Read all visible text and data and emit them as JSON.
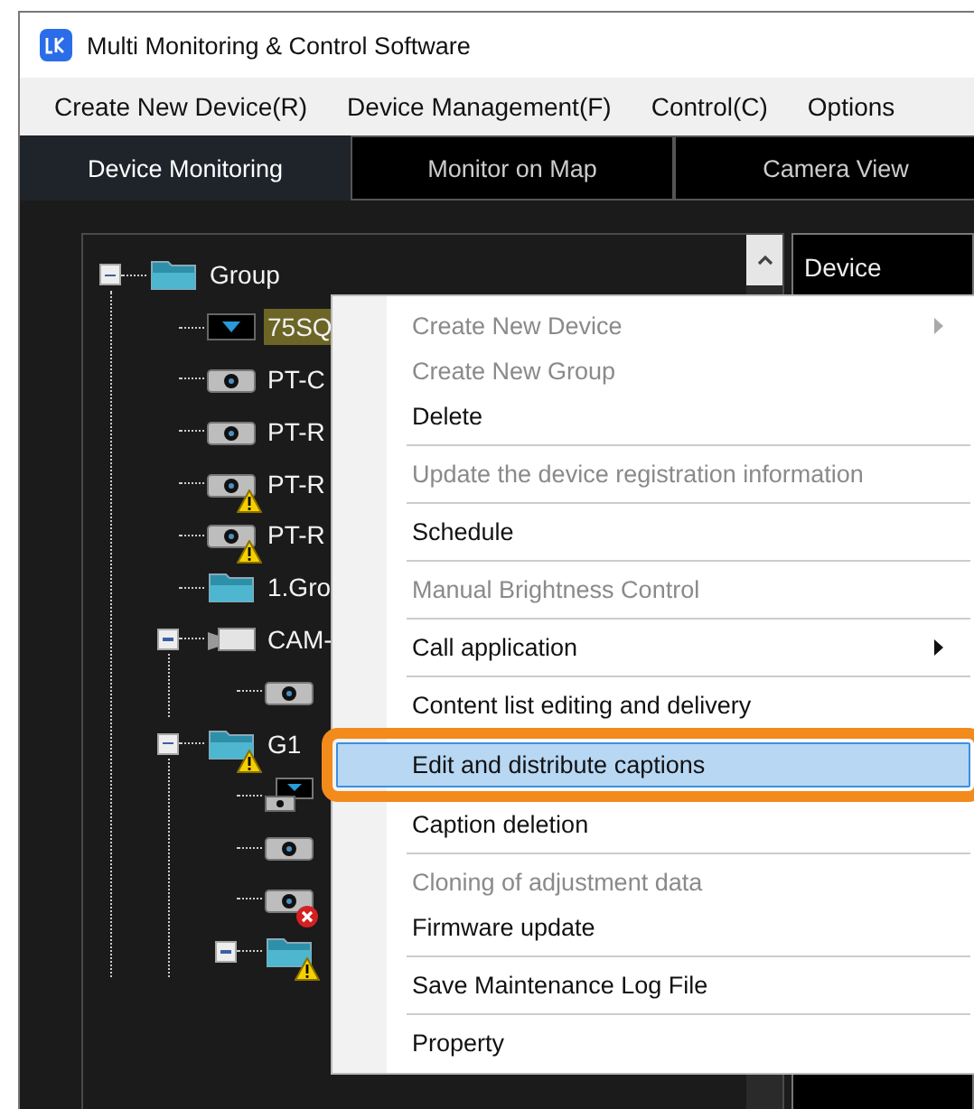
{
  "window": {
    "title": "Multi Monitoring & Control Software"
  },
  "menu_bar": [
    "Create New Device(R)",
    "Device Management(F)",
    "Control(C)",
    "Options"
  ],
  "tabs": [
    {
      "label": "Device Monitoring",
      "selected": true
    },
    {
      "label": "Monitor on Map",
      "selected": false
    },
    {
      "label": "Camera View",
      "selected": false
    }
  ],
  "tree": [
    {
      "label": "Group",
      "kind": "folder",
      "warning": false,
      "error": false,
      "selected": false,
      "expanded": true,
      "children": [
        {
          "label": "75SQ",
          "kind": "monitor",
          "warning": false,
          "error": false,
          "selected": true
        },
        {
          "label": "PT-C",
          "kind": "projector",
          "warning": false,
          "error": false,
          "selected": false
        },
        {
          "label": "PT-R",
          "kind": "projector",
          "warning": false,
          "error": false,
          "selected": false
        },
        {
          "label": "PT-R",
          "kind": "projector",
          "warning": true,
          "error": false,
          "selected": false
        },
        {
          "label": "PT-R",
          "kind": "projector",
          "warning": true,
          "error": false,
          "selected": false
        },
        {
          "label": "1.Gro",
          "kind": "folder",
          "warning": false,
          "error": false,
          "selected": false
        },
        {
          "label": "CAM-",
          "kind": "camera",
          "warning": false,
          "error": false,
          "selected": false,
          "expanded": true,
          "children": [
            {
              "kind": "projector",
              "warning": false,
              "error": false
            }
          ]
        },
        {
          "label": "G1",
          "kind": "folder",
          "warning": true,
          "error": false,
          "selected": false,
          "expanded": true,
          "children": [
            {
              "kind": "combo",
              "warning": false,
              "error": false
            },
            {
              "kind": "projector",
              "warning": false,
              "error": false
            },
            {
              "kind": "projector",
              "warning": false,
              "error": true
            },
            {
              "kind": "folder",
              "warning": true,
              "error": false,
              "expanded": true
            }
          ]
        }
      ]
    }
  ],
  "detail_header": "Device",
  "context_menu": [
    {
      "label": "Create New Device",
      "disabled": true,
      "submenu": true,
      "selected": false
    },
    {
      "label": "Create New Group",
      "disabled": true,
      "submenu": false,
      "selected": false
    },
    {
      "label": "Delete",
      "disabled": false,
      "submenu": false,
      "selected": false,
      "separator_after": true
    },
    {
      "label": "Update the device registration information",
      "disabled": true,
      "submenu": false,
      "selected": false,
      "separator_after": true
    },
    {
      "label": "Schedule",
      "disabled": false,
      "submenu": false,
      "selected": false,
      "separator_after": true
    },
    {
      "label": "Manual Brightness Control",
      "disabled": true,
      "submenu": false,
      "selected": false,
      "separator_after": true
    },
    {
      "label": "Call application",
      "disabled": false,
      "submenu": true,
      "selected": false,
      "separator_after": true
    },
    {
      "label": "Content list editing and delivery",
      "disabled": false,
      "submenu": false,
      "selected": false
    },
    {
      "label": "Edit and distribute captions",
      "disabled": false,
      "submenu": false,
      "selected": true
    },
    {
      "label": "Caption deletion",
      "disabled": false,
      "submenu": false,
      "selected": false,
      "separator_after": true
    },
    {
      "label": "Cloning of adjustment data",
      "disabled": true,
      "submenu": false,
      "selected": false
    },
    {
      "label": "Firmware update",
      "disabled": false,
      "submenu": false,
      "selected": false,
      "separator_after": true
    },
    {
      "label": "Save Maintenance Log File",
      "disabled": false,
      "submenu": false,
      "selected": false,
      "separator_after": true
    },
    {
      "label": "Property",
      "disabled": false,
      "submenu": false,
      "selected": false
    }
  ]
}
